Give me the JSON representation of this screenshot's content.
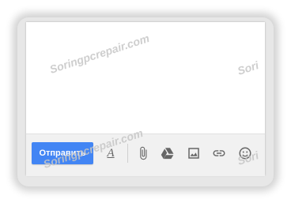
{
  "compose": {
    "send_label": "Отправить"
  },
  "toolbar": {
    "icons": [
      "font-format-icon",
      "attach-icon",
      "drive-icon",
      "insert-photo-icon",
      "insert-link-icon",
      "emoji-icon"
    ]
  },
  "watermark": {
    "text": "Soringpcrepair.com",
    "short": "Sori"
  },
  "colors": {
    "send_button": "#4285f4",
    "toolbar_bg": "#f1f1f1"
  }
}
